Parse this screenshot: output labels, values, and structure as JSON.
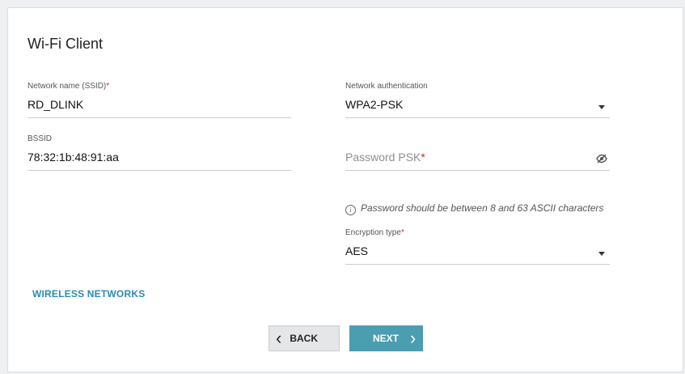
{
  "page": {
    "title": "Wi-Fi Client"
  },
  "fields": {
    "ssid": {
      "label": "Network name (SSID)",
      "required_mark": "*",
      "value": "RD_DLINK"
    },
    "bssid": {
      "label": "BSSID",
      "value": "78:32:1b:48:91:aa"
    },
    "auth": {
      "label": "Network authentication",
      "value": "WPA2-PSK"
    },
    "psk": {
      "placeholder": "Password PSK",
      "required_mark": "*",
      "hint": "Password should be between 8 and 63 ASCII characters",
      "hint_icon": "i"
    },
    "encryption": {
      "label": "Encryption type",
      "required_mark": "*",
      "value": "AES"
    }
  },
  "links": {
    "wireless_networks": "WIRELESS NETWORKS"
  },
  "buttons": {
    "back": "BACK",
    "next": "NEXT",
    "back_icon": "‹",
    "next_icon": "›"
  },
  "icons": {
    "eye_off": "eye-off-icon",
    "dropdown": "chevron-down-icon",
    "info": "info-icon"
  },
  "colors": {
    "accent": "#4b9db0",
    "link": "#2a8cb3",
    "required": "#d2262c"
  }
}
